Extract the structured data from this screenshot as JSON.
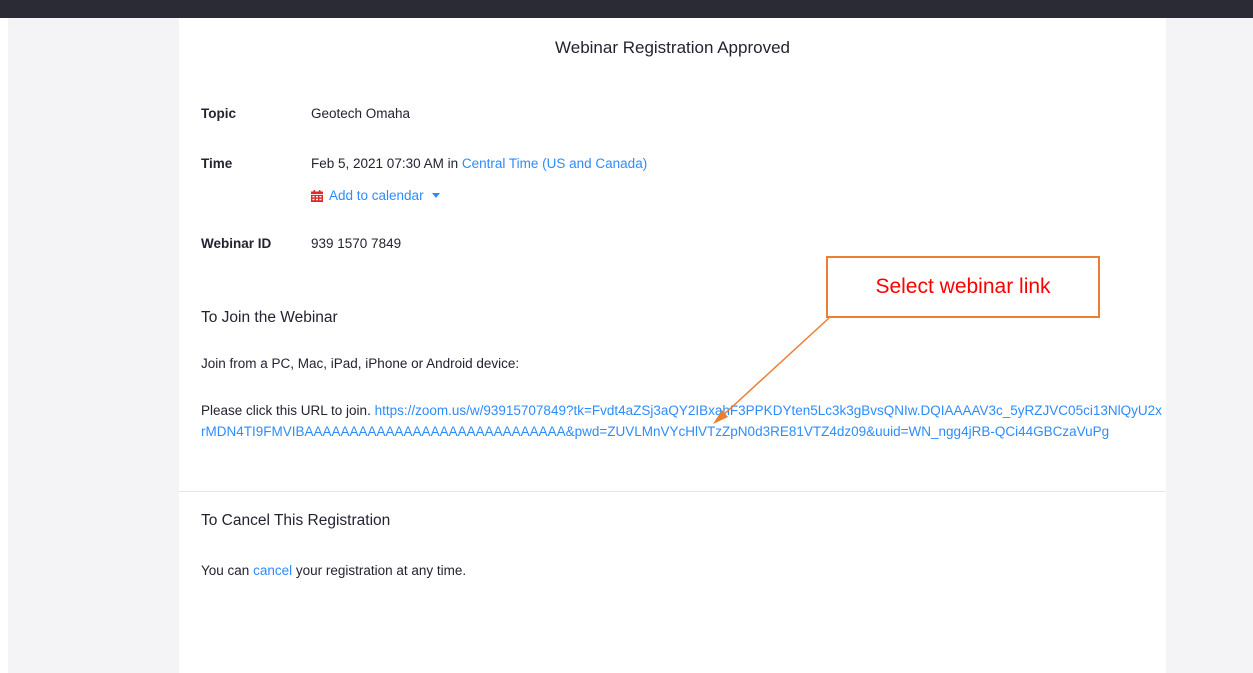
{
  "page": {
    "title": "Webinar Registration Approved"
  },
  "details": {
    "topic_label": "Topic",
    "topic_value": "Geotech Omaha",
    "time_label": "Time",
    "time_prefix": "Feb 5, 2021 07:30 AM in ",
    "timezone_link": "Central Time (US and Canada)",
    "add_calendar_label": "Add to calendar",
    "webinar_id_label": "Webinar ID",
    "webinar_id_value": "939 1570 7849"
  },
  "join": {
    "section_title": "To Join the Webinar",
    "device_text": "Join from a PC, Mac, iPad, iPhone or Android device:",
    "url_prefix": "Please click this URL to join. ",
    "url": "https://zoom.us/w/93915707849?tk=Fvdt4aZSj3aQY2IBxahF3PPKDYten5Lc3k3gBvsQNIw.DQIAAAAV3c_5yRZJVC05ci13NlQyU2xrMDN4TI9FMVIBAAAAAAAAAAAAAAAAAAAAAAAAAAAAA&pwd=ZUVLMnVYcHlVTzZpN0d3RE81VTZ4dz09&uuid=WN_ngg4jRB-QCi44GBCzaVuPg"
  },
  "cancel": {
    "section_title": "To Cancel This Registration",
    "text_before": "You can ",
    "link": "cancel",
    "text_after": " your registration at any time."
  },
  "annotation": {
    "callout_text": "Select webinar link",
    "colors": {
      "border": "#ed7d31",
      "text": "#ff0000",
      "arrow": "#ed7d31"
    }
  },
  "colors": {
    "link": "#2d8cff",
    "calendar_icon": "#e02828",
    "topbar": "#2b2b36"
  }
}
